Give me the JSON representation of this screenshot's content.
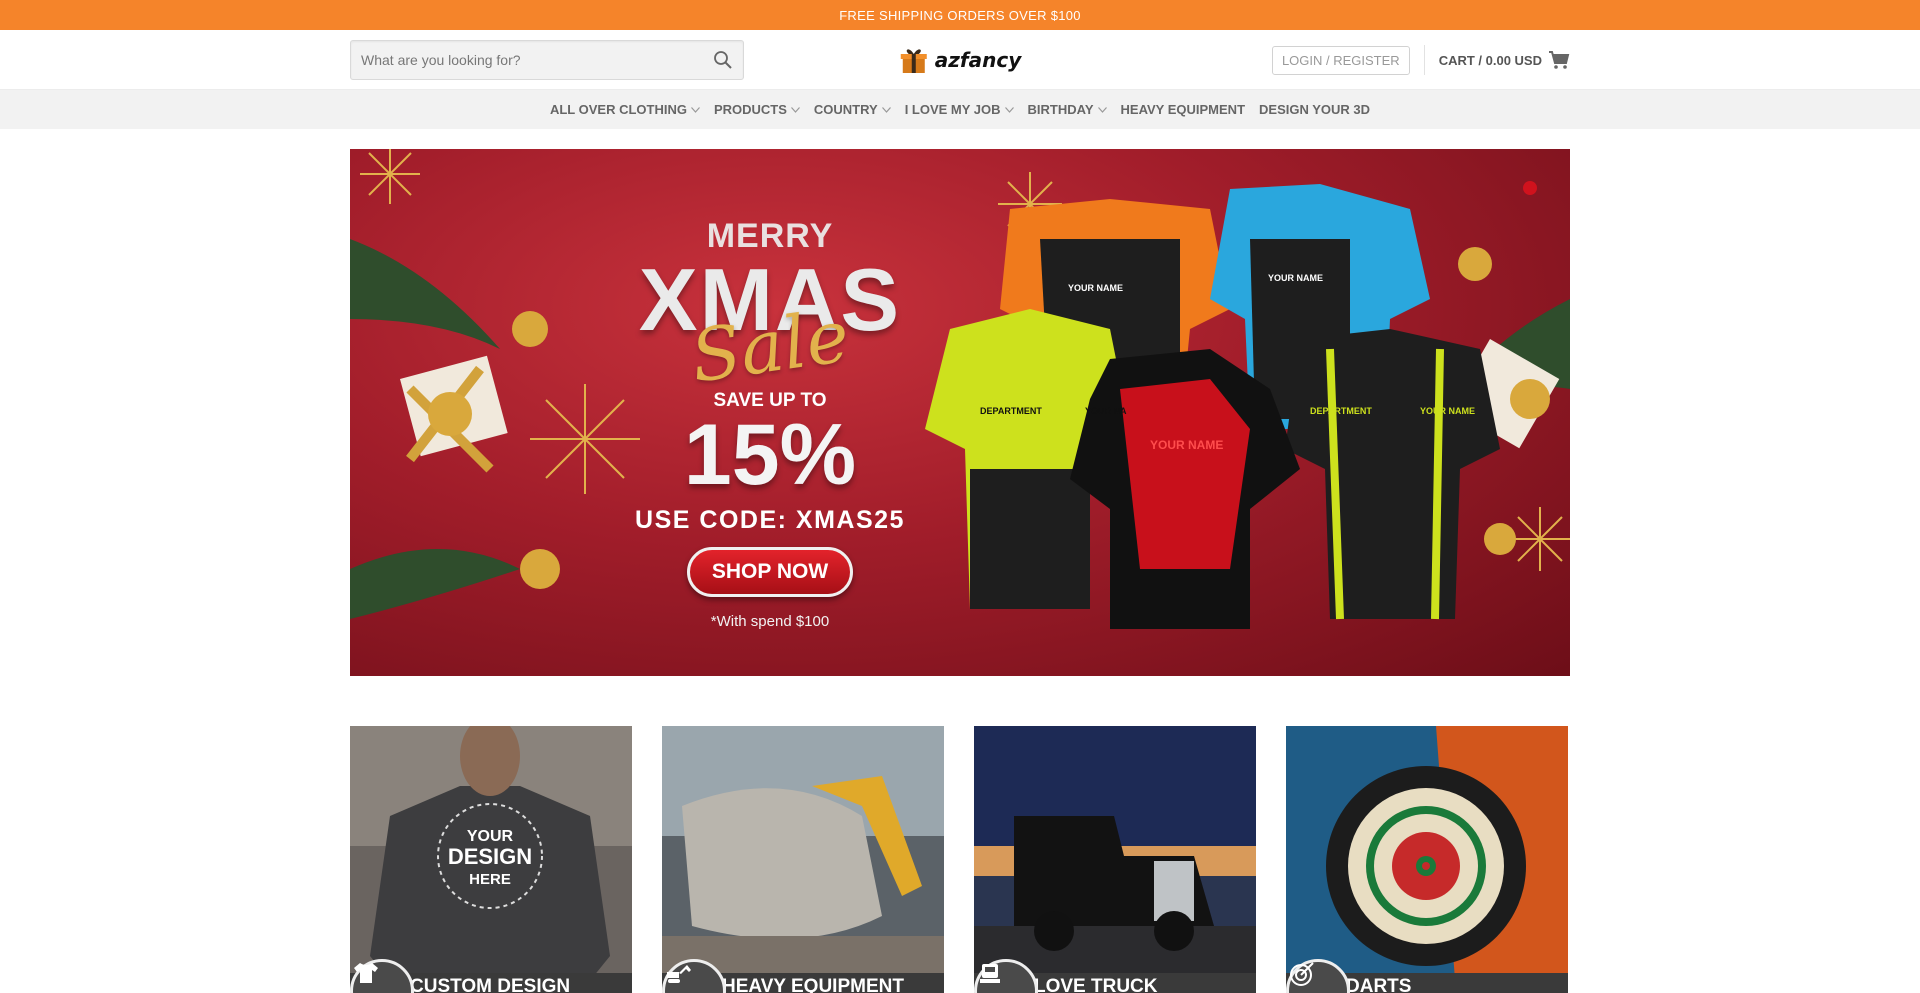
{
  "topbar": {
    "text": "FREE SHIPPING ORDERS OVER $100"
  },
  "header": {
    "search_placeholder": "What are you looking for?",
    "logo_text": "azfancy",
    "login_label": "LOGIN / REGISTER",
    "cart_label": "CART / 0.00 USD"
  },
  "nav": {
    "items": [
      {
        "label": "ALL OVER CLOTHING",
        "has_dropdown": true
      },
      {
        "label": "PRODUCTS",
        "has_dropdown": true
      },
      {
        "label": "COUNTRY",
        "has_dropdown": true
      },
      {
        "label": "I LOVE MY JOB",
        "has_dropdown": true
      },
      {
        "label": "BIRTHDAY",
        "has_dropdown": true
      },
      {
        "label": "HEAVY EQUIPMENT",
        "has_dropdown": false
      },
      {
        "label": "DESIGN YOUR 3D",
        "has_dropdown": false
      }
    ]
  },
  "banner": {
    "merry": "MERRY",
    "xmas": "XMAS",
    "sale": "Sale",
    "save_up_to": "SAVE UP TO",
    "percent": "15%",
    "code": "USE CODE: XMAS25",
    "shop_now": "SHOP NOW",
    "note": "*With spend $100",
    "shirt_tags": [
      "YOUR NAME",
      "YOUR NAME",
      "DEPARTMENT",
      "YOUR NA",
      "YOUR NAME",
      "DEPARTMENT",
      "YOUR NAME"
    ]
  },
  "cards": [
    {
      "label": "CUSTOM DESIGN",
      "icon": "tshirt-icon",
      "image_text": [
        "YOUR",
        "DESIGN",
        "HERE"
      ]
    },
    {
      "label": "HEAVY EQUIPMENT",
      "icon": "excavator-icon"
    },
    {
      "label": "LOVE TRUCK",
      "icon": "truck-icon"
    },
    {
      "label": "DARTS",
      "icon": "target-icon"
    }
  ],
  "colors": {
    "topbar": "#f5842a",
    "nav_bg": "#f2f2f2",
    "banner_red": "#a11d2a",
    "gold": "#e2b24c",
    "card_label_bg": "#3a3a3a"
  }
}
